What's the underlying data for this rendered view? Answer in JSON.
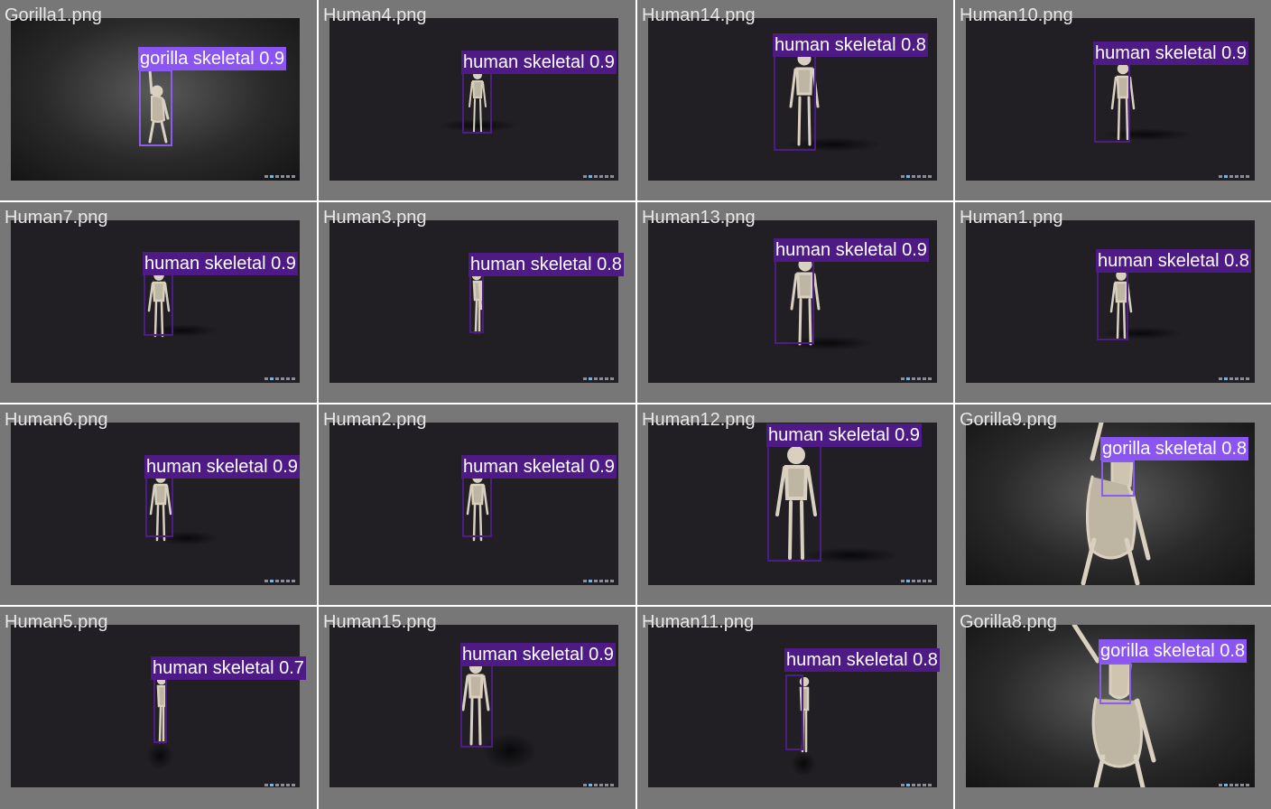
{
  "grid_title": "",
  "colors": {
    "human_box": "#4e1a86",
    "gorilla_box": "#8a55f2",
    "tile_border": "#777777"
  },
  "tiles": [
    {
      "file": "Gorilla1.png",
      "label": "gorilla skeletal 0.9",
      "class": "gorilla skeletal",
      "confidence": 0.9
    },
    {
      "file": "Human4.png",
      "label": "human skeletal 0.9",
      "class": "human skeletal",
      "confidence": 0.9
    },
    {
      "file": "Human14.png",
      "label": "human skeletal 0.8",
      "class": "human skeletal",
      "confidence": 0.8
    },
    {
      "file": "Human10.png",
      "label": "human skeletal 0.9",
      "class": "human skeletal",
      "confidence": 0.9
    },
    {
      "file": "Human7.png",
      "label": "human skeletal 0.9",
      "class": "human skeletal",
      "confidence": 0.9
    },
    {
      "file": "Human3.png",
      "label": "human skeletal 0.8",
      "class": "human skeletal",
      "confidence": 0.8
    },
    {
      "file": "Human13.png",
      "label": "human skeletal 0.9",
      "class": "human skeletal",
      "confidence": 0.9
    },
    {
      "file": "Human1.png",
      "label": "human skeletal 0.8",
      "class": "human skeletal",
      "confidence": 0.8
    },
    {
      "file": "Human6.png",
      "label": "human skeletal 0.9",
      "class": "human skeletal",
      "confidence": 0.9
    },
    {
      "file": "Human2.png",
      "label": "human skeletal 0.9",
      "class": "human skeletal",
      "confidence": 0.9
    },
    {
      "file": "Human12.png",
      "label": "human skeletal 0.9",
      "class": "human skeletal",
      "confidence": 0.9
    },
    {
      "file": "Gorilla9.png",
      "label": "gorilla skeletal 0.8",
      "class": "gorilla skeletal",
      "confidence": 0.8
    },
    {
      "file": "Human5.png",
      "label": "human skeletal 0.7",
      "class": "human skeletal",
      "confidence": 0.7
    },
    {
      "file": "Human15.png",
      "label": "human skeletal 0.9",
      "class": "human skeletal",
      "confidence": 0.9
    },
    {
      "file": "Human11.png",
      "label": "human skeletal 0.8",
      "class": "human skeletal",
      "confidence": 0.8
    },
    {
      "file": "Gorilla8.png",
      "label": "gorilla skeletal 0.8",
      "class": "gorilla skeletal",
      "confidence": 0.8
    }
  ]
}
